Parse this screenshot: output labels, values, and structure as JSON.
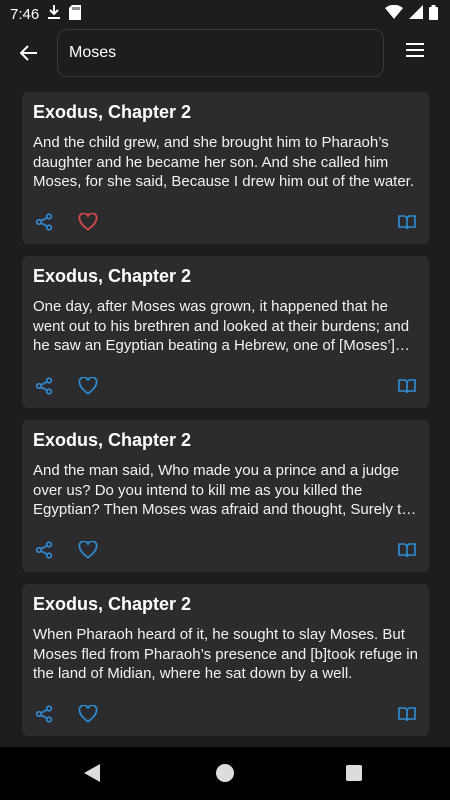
{
  "status_bar": {
    "time": "7:46"
  },
  "search": {
    "value": "Moses"
  },
  "results": [
    {
      "title": "Exodus, Chapter 2",
      "text": " And the child grew, and she brought him to Pharaoh’s daughter and he became her son. And she called him Moses, for she said, Because I drew him out of the water.",
      "favorited": true
    },
    {
      "title": "Exodus, Chapter 2",
      "text": " One day, after Moses was grown, it happened that he went out to his brethren and looked at their burdens; and he saw an Egyptian beating a Hebrew, one of [Moses’] b…",
      "favorited": false
    },
    {
      "title": "Exodus, Chapter 2",
      "text": " And the man said, Who made you a prince and a judge over us? Do you intend to kill me as you killed the Egyptian? Then Moses was afraid and thought, Surely t…",
      "favorited": false
    },
    {
      "title": "Exodus, Chapter 2",
      "text": " When Pharaoh heard of it, he sought to slay Moses. But Moses fled from Pharaoh’s presence and [b]took refuge in the land of Midian, where he sat down by a well.",
      "favorited": false
    }
  ],
  "colors": {
    "accent": "#2f8fd8",
    "favorite": "#e24b4b",
    "card": "#2c2c2e",
    "background": "#1d1d1f"
  },
  "icons": [
    "download-icon",
    "sd-card-icon",
    "wifi-icon",
    "signal-icon",
    "battery-icon",
    "back-arrow-icon",
    "menu-icon",
    "share-icon",
    "heart-icon",
    "book-icon"
  ]
}
